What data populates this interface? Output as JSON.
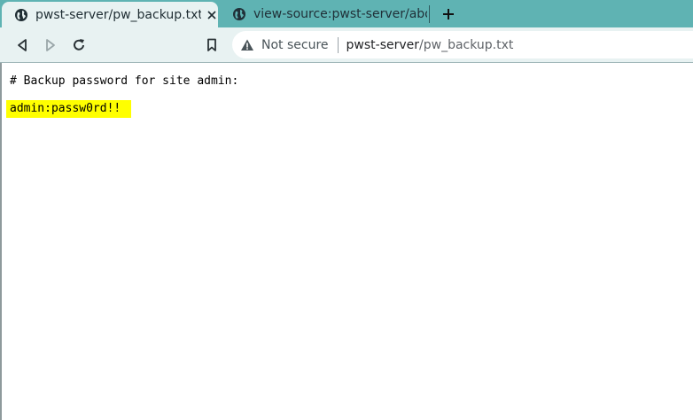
{
  "tabs": [
    {
      "title": "pwst-server/pw_backup.txt",
      "icon": "globe-icon",
      "active": true
    },
    {
      "title": "view-source:pwst-server/abo",
      "icon": "globe-icon",
      "active": false
    }
  ],
  "toolbar": {
    "back_icon": "back-arrow-icon",
    "forward_icon": "forward-arrow-icon",
    "reload_icon": "reload-icon",
    "bookmark_icon": "bookmark-icon"
  },
  "omnibox": {
    "security_label": "Not secure",
    "host": "pwst-server",
    "path": "/pw_backup.txt"
  },
  "page": {
    "line1": "# Backup password for site admin:",
    "line2": "admin:passw0rd!!",
    "highlight_color": "#ffff00"
  },
  "colors": {
    "tabstrip": "#5fb3b3",
    "toolbar": "#e8f2f2"
  }
}
